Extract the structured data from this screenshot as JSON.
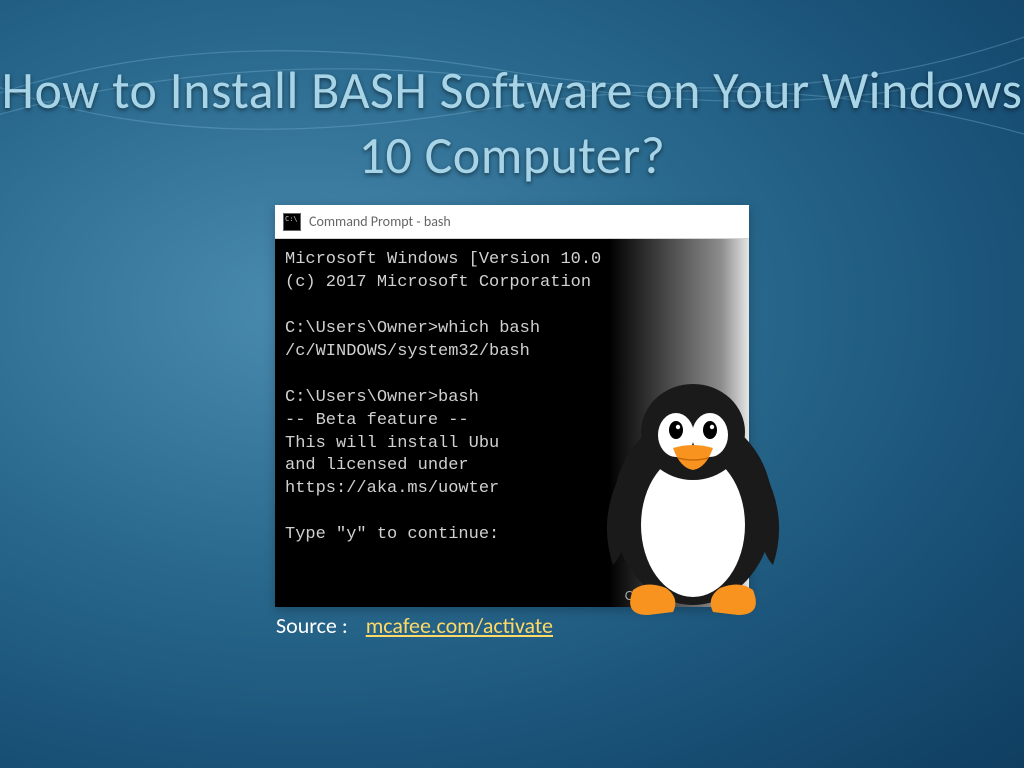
{
  "title": "How to Install BASH Software on Your Windows 10 Computer?",
  "window": {
    "title": "Command Prompt - bash"
  },
  "terminal": {
    "lines": "Microsoft Windows [Version 10.0\n(c) 2017 Microsoft Corporation\n\nC:\\Users\\Owner>which bash\n/c/WINDOWS/system32/bash\n\nC:\\Users\\Owner>bash\n-- Beta feature --\nThis will install Ubu\nand licensed under \nhttps://aka.ms/uowter\n\nType \"y\" to continue: "
  },
  "watermark": "ComputerHope.com",
  "source_label": "Source :",
  "source_link": "mcafee.com/activate"
}
